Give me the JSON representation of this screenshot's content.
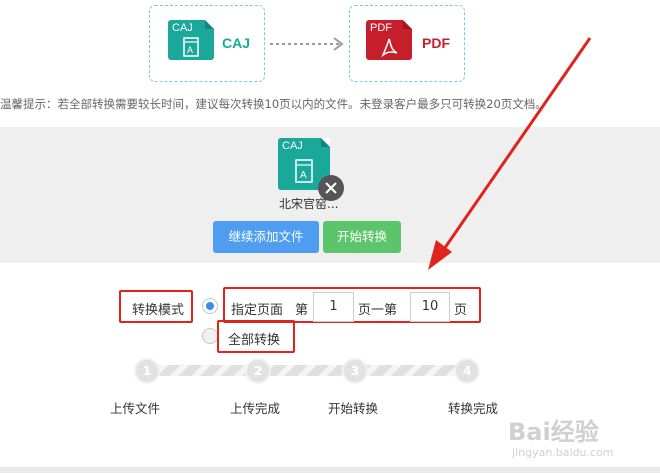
{
  "formats": {
    "source": {
      "icon_text": "CAJ",
      "label": "CAJ",
      "color": "#1aa89a"
    },
    "target": {
      "icon_text": "PDF",
      "label": "PDF",
      "color": "#c61f2c"
    }
  },
  "tip": "温馨提示：若全部转换需要较长时间，建议每次转换10页以内的文件。未登录客户最多只可转换20页文档。",
  "upload": {
    "file_icon_text": "CAJ",
    "file_name": "北宋官窑...",
    "add_button": "继续添加文件",
    "start_button": "开始转换",
    "add_color": "#4e9df0",
    "start_color": "#5cc46a"
  },
  "mode": {
    "label": "转换模式",
    "option_range": "指定页面",
    "from_prefix": "第",
    "from_value": "1",
    "mid_text": "页一第",
    "to_value": "10",
    "to_suffix": "页",
    "option_all": "全部转换"
  },
  "steps": [
    {
      "num": "1",
      "label": "上传文件"
    },
    {
      "num": "2",
      "label": "上传完成"
    },
    {
      "num": "3",
      "label": "开始转换"
    },
    {
      "num": "4",
      "label": "转换完成"
    }
  ],
  "watermark": {
    "text": "Bai经验",
    "sub": "jingyan.baidu.com"
  }
}
